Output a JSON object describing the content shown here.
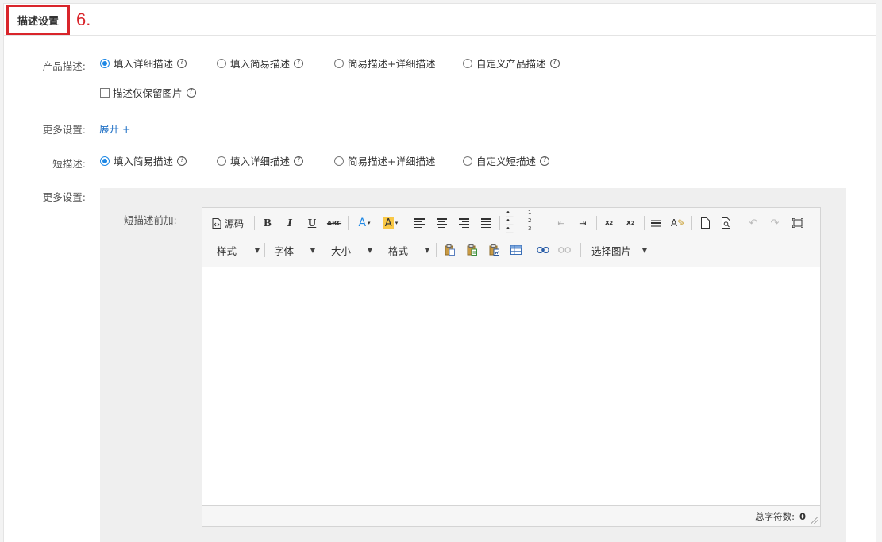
{
  "section": {
    "title": "描述设置",
    "step_marker": "6."
  },
  "product_desc": {
    "label": "产品描述:",
    "options": [
      "填入详细描述",
      "填入简易描述",
      "简易描述+详细描述",
      "自定义产品描述"
    ],
    "selected_index": 0,
    "keep_images_only_label": "描述仅保留图片",
    "keep_images_only_checked": false
  },
  "more_settings_1": {
    "label": "更多设置:",
    "expand_link": "展开 +"
  },
  "short_desc": {
    "label": "短描述:",
    "options": [
      "填入简易描述",
      "填入详细描述",
      "简易描述+详细描述",
      "自定义短描述"
    ],
    "selected_index": 0
  },
  "more_settings_2": {
    "label": "更多设置:"
  },
  "editor": {
    "prefix_label": "短描述前加:",
    "toolbar": {
      "source_label": "源码",
      "dropdowns": [
        "样式",
        "字体",
        "大小",
        "格式",
        "选择图片"
      ]
    },
    "content": "",
    "char_count_label": "总字符数:",
    "char_count_value": "0"
  },
  "colors": {
    "accent": "#1e88e5",
    "highlight_border": "#d9252b",
    "link": "#1e6fc5"
  },
  "help_glyph": "?"
}
